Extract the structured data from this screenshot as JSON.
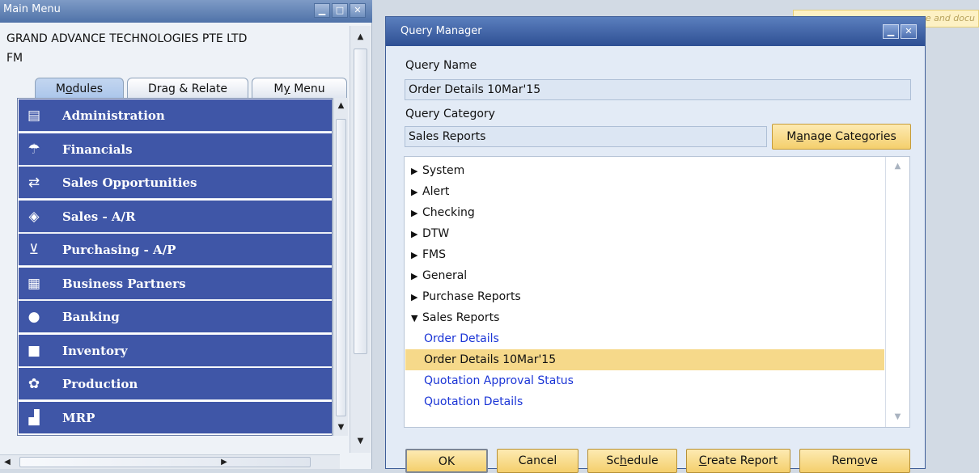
{
  "main_menu": {
    "title": "Main Menu",
    "company": "GRAND ADVANCE TECHNOLOGIES PTE LTD",
    "user": "FM",
    "tabs": [
      {
        "label_pre": "M",
        "label_ul": "o",
        "label_post": "dules"
      },
      {
        "label_pre": "Drag & Relate",
        "label_ul": "",
        "label_post": ""
      },
      {
        "label_pre": "M",
        "label_ul": "y",
        "label_post": " Menu"
      }
    ],
    "modules": [
      {
        "label": "Administration",
        "icon": "document-icon",
        "glyph": "▤"
      },
      {
        "label": "Financials",
        "icon": "financials-icon",
        "glyph": "☂"
      },
      {
        "label": "Sales Opportunities",
        "icon": "sales-opportunities-icon",
        "glyph": "⇄"
      },
      {
        "label": "Sales - A/R",
        "icon": "sales-tag-icon",
        "glyph": "◈"
      },
      {
        "label": "Purchasing - A/P",
        "icon": "cart-icon",
        "glyph": "⊻"
      },
      {
        "label": "Business Partners",
        "icon": "business-partners-icon",
        "glyph": "▦"
      },
      {
        "label": "Banking",
        "icon": "coins-icon",
        "glyph": "●"
      },
      {
        "label": "Inventory",
        "icon": "box-icon",
        "glyph": "■"
      },
      {
        "label": "Production",
        "icon": "gear-icon",
        "glyph": "✿"
      },
      {
        "label": "MRP",
        "icon": "mrp-icon",
        "glyph": "▟"
      }
    ]
  },
  "background": {
    "strip_text": "e and docu"
  },
  "query_manager": {
    "title": "Query Manager",
    "query_name_label": "Query Name",
    "query_name_value": "Order Details 10Mar'15",
    "query_category_label": "Query Category",
    "query_category_value": "Sales Reports",
    "manage_categories": {
      "pre": "M",
      "ul": "a",
      "post": "nage Categories"
    },
    "tree": [
      {
        "label": "System",
        "kind": "collapsed"
      },
      {
        "label": "Alert",
        "kind": "collapsed"
      },
      {
        "label": "Checking",
        "kind": "collapsed"
      },
      {
        "label": "DTW",
        "kind": "collapsed"
      },
      {
        "label": "FMS",
        "kind": "collapsed"
      },
      {
        "label": "General",
        "kind": "collapsed"
      },
      {
        "label": "Purchase Reports",
        "kind": "collapsed"
      },
      {
        "label": "Sales Reports",
        "kind": "expanded"
      },
      {
        "label": "Order Details",
        "kind": "query"
      },
      {
        "label": "Order Details 10Mar'15",
        "kind": "selected"
      },
      {
        "label": "Quotation Approval Status",
        "kind": "query"
      },
      {
        "label": "Quotation Details",
        "kind": "query"
      }
    ],
    "buttons": {
      "ok": "OK",
      "cancel": "Cancel",
      "schedule": {
        "pre": "Sc",
        "ul": "h",
        "post": "edule"
      },
      "create_report": {
        "pre": "",
        "ul": "C",
        "post": "reate Report"
      },
      "remove": {
        "pre": "Rem",
        "ul": "o",
        "post": "ve"
      }
    }
  },
  "colors": {
    "module_bg": "#3f56a7",
    "selected_row": "#f6d98a",
    "query_link": "#1b35d6",
    "button_gold": "#f4cf6c"
  }
}
